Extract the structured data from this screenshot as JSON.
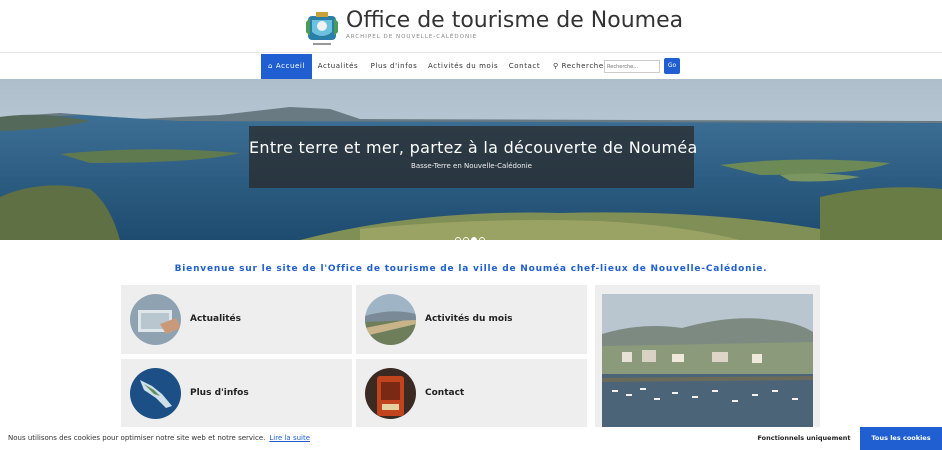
{
  "header": {
    "title": "Office de tourisme de Noumea",
    "subtitle": "ARCHIPEL DE NOUVELLE-CALÉDONIE"
  },
  "nav": {
    "items": [
      {
        "label": "Accueil",
        "icon": "home-icon",
        "active": true
      },
      {
        "label": "Actualités"
      },
      {
        "label": "Plus d'infos"
      },
      {
        "label": "Activités du mois"
      },
      {
        "label": "Contact"
      }
    ],
    "search_label": "Recherche",
    "search_placeholder": "Recherche...",
    "go_label": "Go"
  },
  "hero": {
    "title": "Entre terre et mer, partez à la découverte de Nouméa",
    "subtitle": "Basse-Terre en Nouvelle-Calédonie",
    "slide_count": 4,
    "active_slide": 3
  },
  "welcome": "Bienvenue sur le site de l'Office de tourisme de la ville de Nouméa chef-lieux de Nouvelle-Calédonie.",
  "tiles": [
    {
      "label": "Actualités"
    },
    {
      "label": "Activités du mois"
    },
    {
      "label": "Plus d'infos"
    },
    {
      "label": "Contact"
    }
  ],
  "cookie": {
    "text": "Nous utilisons des cookies pour optimiser notre site web et notre service.",
    "link": "Lire la suite",
    "functional_label": "Fonctionnels uniquement",
    "accept_label": "Tous les cookies"
  },
  "colors": {
    "accent": "#1f5fd1",
    "tile_bg": "#eeeeee"
  }
}
